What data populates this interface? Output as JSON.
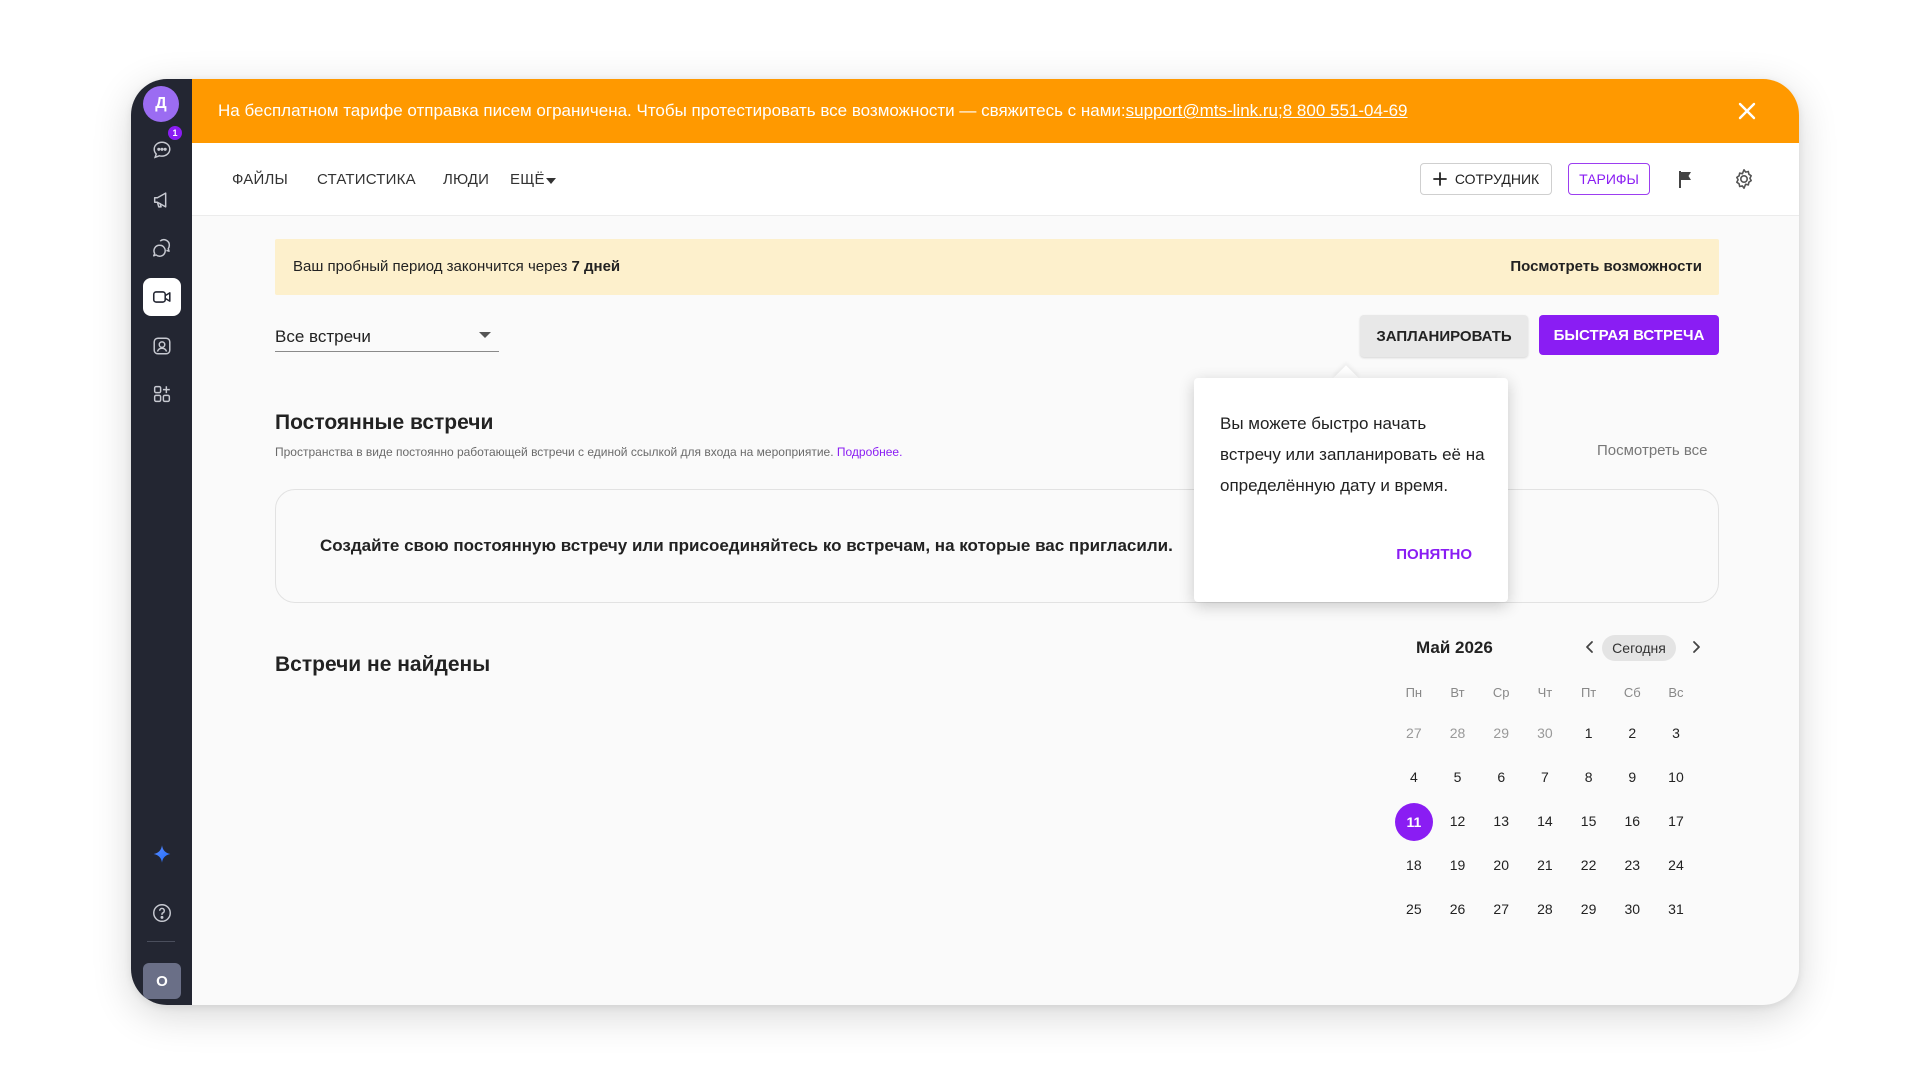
{
  "sidebar": {
    "user_initial": "Д",
    "chat_badge": "1",
    "bottom_initial": "О",
    "icons": [
      "chat-icon",
      "megaphone-icon",
      "discussion-icon",
      "video-meeting-icon",
      "contact-search-icon",
      "apps-icon",
      "sparkle-icon",
      "help-icon"
    ]
  },
  "banner": {
    "text": "На бесплатном тарифе отправка писем ограничена. Чтобы протестировать все возможности — свяжитесь с нами: ",
    "email": "support@mts-link.ru",
    "separator": "; ",
    "phone": "8 800 551-04-69",
    "bg_color": "#ff9900"
  },
  "nav": {
    "files": "ФАЙЛЫ",
    "stats": "СТАТИСТИКА",
    "people": "ЛЮДИ",
    "more": "ЕЩЁ",
    "employee_button": "СОТРУДНИК",
    "tariffs_button": "ТАРИФЫ"
  },
  "trial": {
    "text": "Ваш пробный период закончится через ",
    "days": "7 дней",
    "link": "Посмотреть возможности"
  },
  "filter": {
    "selected": "Все встречи"
  },
  "actions": {
    "schedule": "ЗАПЛАНИРОВАТЬ",
    "quick": "БЫСТРАЯ ВСТРЕЧА",
    "accent_color": "#8a1df3"
  },
  "permanent": {
    "title": "Постоянные встречи",
    "desc": "Пространства в виде постоянно работающей встречи с единой ссылкой для входа на мероприятие. ",
    "more_link": "Подробнее.",
    "view_all": "Посмотреть все",
    "empty_text": "Создайте свою постоянную встречу или присоединяйтесь ко встречам, на которые вас пригласили."
  },
  "tooltip": {
    "text": "Вы можете быстро начать встречу или запланировать её на определённую дату и время.",
    "ok": "ПОНЯТНО"
  },
  "meetings": {
    "empty": "Встречи не найдены"
  },
  "calendar": {
    "month": "Май 2026",
    "today": "Сегодня",
    "weekdays": [
      "Пн",
      "Вт",
      "Ср",
      "Чт",
      "Пт",
      "Сб",
      "Вс"
    ],
    "weeks": [
      [
        "27",
        "28",
        "29",
        "30",
        "1",
        "2",
        "3"
      ],
      [
        "4",
        "5",
        "6",
        "7",
        "8",
        "9",
        "10"
      ],
      [
        "11",
        "12",
        "13",
        "14",
        "15",
        "16",
        "17"
      ],
      [
        "18",
        "19",
        "20",
        "21",
        "22",
        "23",
        "24"
      ],
      [
        "25",
        "26",
        "27",
        "28",
        "29",
        "30",
        "31"
      ]
    ],
    "selected": "11"
  }
}
